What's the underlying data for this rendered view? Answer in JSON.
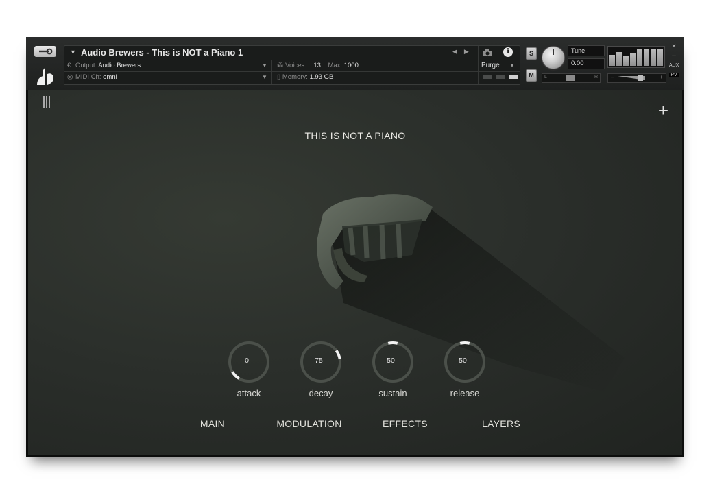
{
  "header": {
    "instrument_name": "Audio Brewers - This is NOT a Piano 1",
    "output_label": "Output:",
    "output_value": "Audio Brewers",
    "midi_label": "MIDI Ch:",
    "midi_value": "omni",
    "voices_label": "Voices:",
    "voices_value": "13",
    "max_label": "Max:",
    "max_value": "1000",
    "memory_label": "Memory:",
    "memory_value": "1.93 GB",
    "purge_label": "Purge",
    "solo_label": "S",
    "mute_label": "M",
    "tune_label": "Tune",
    "tune_value": "0.00",
    "pan_left": "L",
    "pan_right": "R",
    "close_label": "×",
    "minimize_label": "–",
    "aux_label": "AUX",
    "pv_label": "PV"
  },
  "main": {
    "title": "THIS IS NOT A PIANO",
    "knobs": [
      {
        "label": "attack",
        "value": "0",
        "level": 0.0
      },
      {
        "label": "decay",
        "value": "75",
        "level": 0.75
      },
      {
        "label": "sustain",
        "value": "50",
        "level": 0.5
      },
      {
        "label": "release",
        "value": "50",
        "level": 0.5
      }
    ],
    "tabs": [
      {
        "label": "MAIN",
        "active": true
      },
      {
        "label": "MODULATION",
        "active": false
      },
      {
        "label": "EFFECTS",
        "active": false
      },
      {
        "label": "LAYERS",
        "active": false
      }
    ]
  },
  "colors": {
    "accent": "#e6e6e6",
    "panel_bg": "#2b2f2b",
    "header_bg": "#1a1c1b"
  },
  "icons": [
    "wrench-icon",
    "brand-logo-icon",
    "camera-icon",
    "info-icon",
    "collapse-bars-icon",
    "plus-icon",
    "dropdown-arrow-icon"
  ]
}
